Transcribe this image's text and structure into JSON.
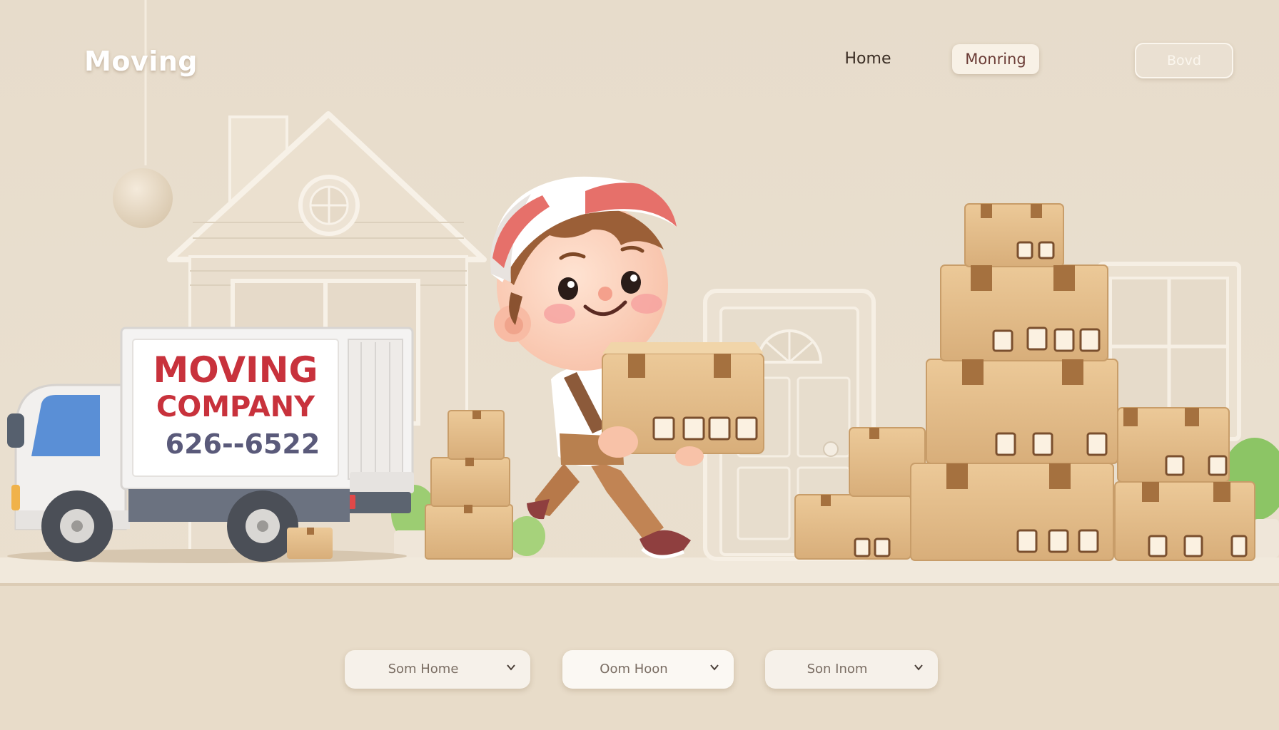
{
  "header": {
    "brand": "Moving",
    "nav": {
      "home": "Home",
      "moving": "Monring",
      "book": "Bovd"
    }
  },
  "truck": {
    "sign_line1": "MOVING",
    "sign_line2": "COMPANY",
    "sign_phone": "626--6522"
  },
  "selectors": [
    {
      "label": "Som Home"
    },
    {
      "label": "Oom Hoon"
    },
    {
      "label": "Son Inom"
    }
  ],
  "colors": {
    "background": "#e7dccb",
    "sign_text": "#c8323c",
    "phone_text": "#5a5a7a",
    "cardboard": "#e2bf8e",
    "cap": "#e6706a"
  },
  "icons": [
    "chevron-down-icon"
  ]
}
